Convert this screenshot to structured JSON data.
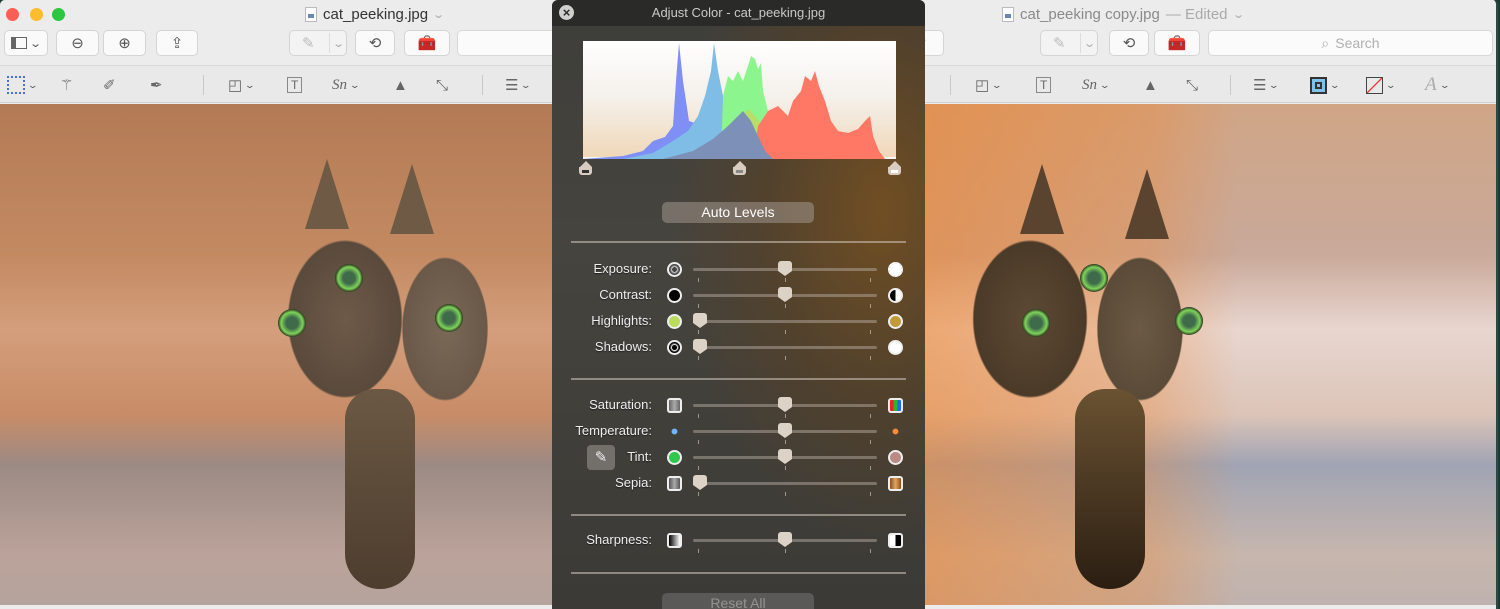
{
  "left_window": {
    "title": "cat_peeking.jpg",
    "toolbar": {
      "sidebar_button": "sidebar-toggle",
      "zoom_out": "−",
      "zoom_in": "+",
      "share": "share"
    },
    "image": "cat peeking photo (original)"
  },
  "right_window": {
    "title": "cat_peeking copy.jpg",
    "edited_label": "— Edited",
    "search_placeholder": "Search",
    "image": "cat peeking photo (color adjusted)"
  },
  "adjust_panel": {
    "title": "Adjust Color - cat_peeking.jpg",
    "auto_levels_label": "Auto Levels",
    "reset_all_label": "Reset All",
    "levels": {
      "black_point": 0.0,
      "midtone": 0.5,
      "white_point": 1.0
    },
    "histogram_colors": {
      "blue": "#7f8ff5",
      "cyan": "#7fbde6",
      "green": "#8df58e",
      "yellowgreen": "#b7df68",
      "red": "#ff7866",
      "gray": "#7d91b8"
    },
    "sliders_group1": [
      {
        "label": "Exposure:",
        "value": 0.5,
        "left_icon": "aperture-closed-icon",
        "right_icon": "aperture-open-icon"
      },
      {
        "label": "Contrast:",
        "value": 0.5,
        "left_icon": "contrast-low-icon",
        "right_icon": "contrast-high-icon"
      },
      {
        "label": "Highlights:",
        "value": 0.0,
        "left_icon": "highlights-low-icon",
        "right_icon": "highlights-high-icon"
      },
      {
        "label": "Shadows:",
        "value": 0.0,
        "left_icon": "shadows-low-icon",
        "right_icon": "shadows-high-icon"
      }
    ],
    "sliders_group2": [
      {
        "label": "Saturation:",
        "value": 0.5,
        "left_icon": "saturation-low-icon",
        "right_icon": "saturation-high-icon"
      },
      {
        "label": "Temperature:",
        "value": 0.5,
        "left_icon": "temperature-cool-icon",
        "right_icon": "temperature-warm-icon"
      },
      {
        "label": "Tint:",
        "value": 0.5,
        "left_icon": "tint-green-icon",
        "right_icon": "tint-magenta-icon"
      },
      {
        "label": "Sepia:",
        "value": 0.0,
        "left_icon": "sepia-low-icon",
        "right_icon": "sepia-high-icon"
      }
    ],
    "sliders_group3": [
      {
        "label": "Sharpness:",
        "value": 0.5,
        "left_icon": "sharpness-low-icon",
        "right_icon": "sharpness-high-icon"
      }
    ],
    "eyedropper_icon": "eyedropper-icon"
  },
  "colors": {
    "close": "#fc5f57",
    "minimize": "#fdbb2e",
    "maximize": "#29c840",
    "accent_blue": "#4a6fe3"
  }
}
